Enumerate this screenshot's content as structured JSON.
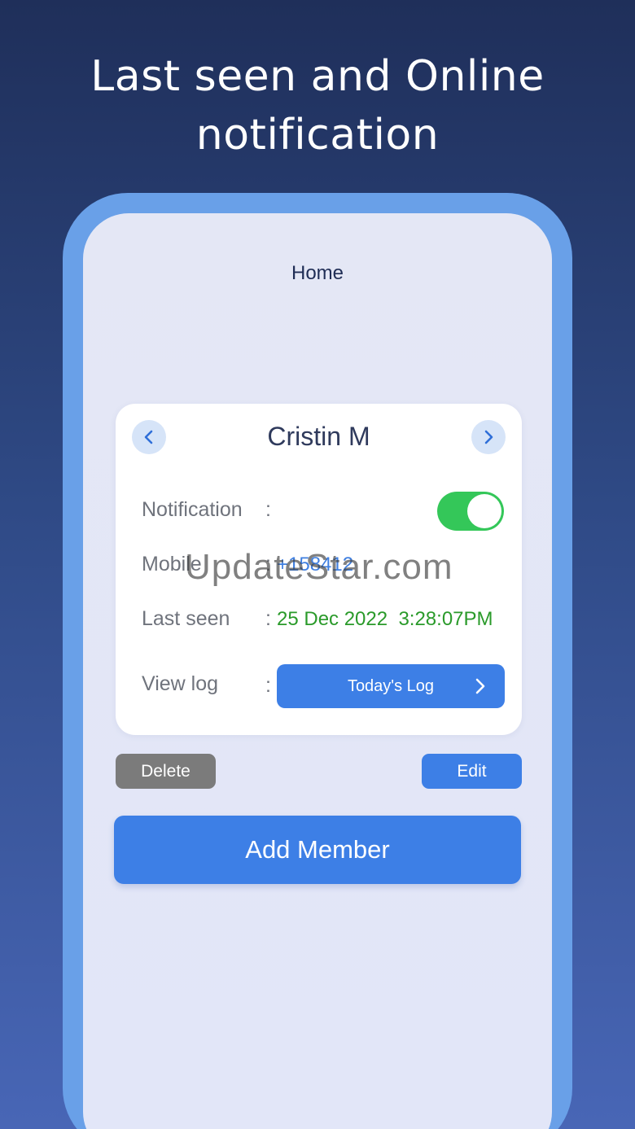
{
  "headline": {
    "line1": "Last seen and Online",
    "line2": "notification"
  },
  "screen": {
    "title": "Home"
  },
  "card": {
    "name": "Cristin M",
    "rows": {
      "notification_label": "Notification",
      "notification_colon": ":",
      "notification_on": true,
      "mobile_label": "Mobile",
      "mobile_colon": ":",
      "mobile_value": "+158412",
      "lastseen_label": "Last seen",
      "lastseen_colon": ":",
      "lastseen_value": "25 Dec 2022  3:28:07PM",
      "viewlog_label": "View log",
      "viewlog_colon": ":",
      "viewlog_button": "Today's Log"
    }
  },
  "actions": {
    "delete": "Delete",
    "edit": "Edit",
    "add_member": "Add Member"
  },
  "watermark": "UpdateStar.com",
  "colors": {
    "accent": "#3d7fe6",
    "toggle_on": "#34c759",
    "last_seen": "#2a9a2a",
    "delete": "#7b7b7b"
  },
  "icons": {
    "prev": "chevron-left-icon",
    "next": "chevron-right-icon",
    "log": "chevron-right-icon"
  }
}
